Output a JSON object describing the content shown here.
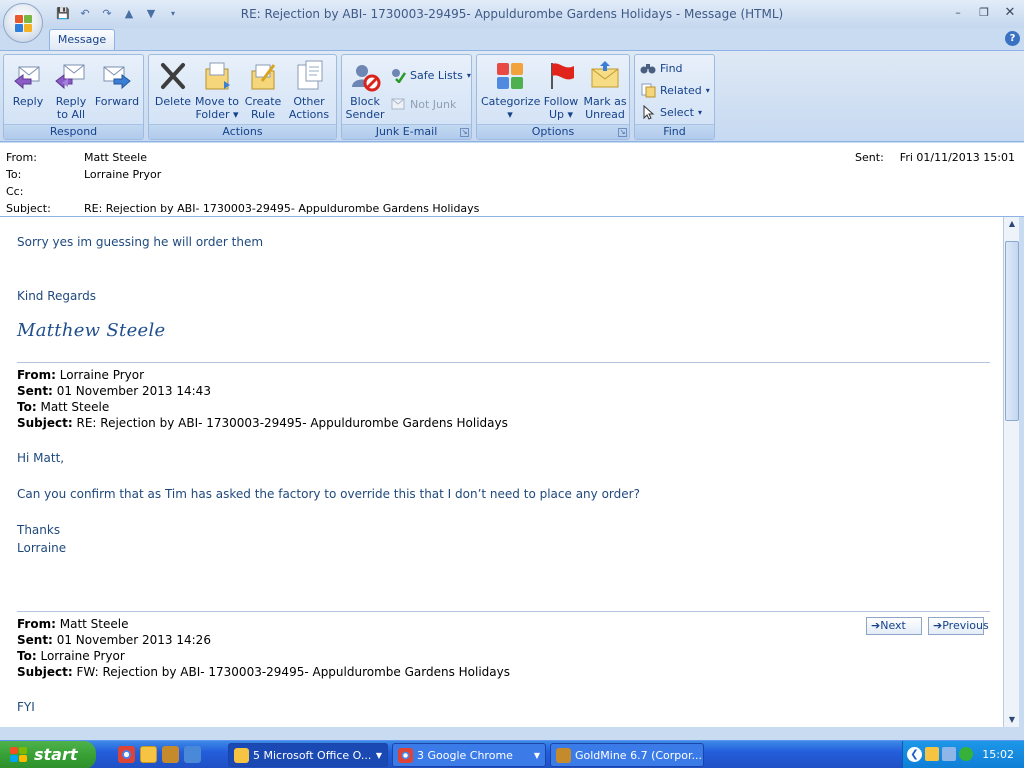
{
  "window": {
    "title": "RE: Rejection by ABI- 1730003-29495- Appuldurombe Gardens Holidays - Message (HTML)"
  },
  "ribbon": {
    "tab": "Message",
    "groups": {
      "respond": "Respond",
      "actions": "Actions",
      "junk": "Junk E-mail",
      "options": "Options",
      "find": "Find"
    },
    "reply": "Reply",
    "reply_all_1": "Reply",
    "reply_all_2": "to All",
    "forward": "Forward",
    "delete": "Delete",
    "move_1": "Move to",
    "move_2": "Folder",
    "create_1": "Create",
    "create_2": "Rule",
    "other_1": "Other",
    "other_2": "Actions",
    "block_1": "Block",
    "block_2": "Sender",
    "safe_lists": "Safe Lists",
    "not_junk": "Not Junk",
    "categorize": "Categorize",
    "follow_1": "Follow",
    "follow_2": "Up",
    "mark_1": "Mark as",
    "mark_2": "Unread",
    "find": "Find",
    "related": "Related",
    "select": "Select"
  },
  "header": {
    "from_label": "From:",
    "from": "Matt Steele",
    "to_label": "To:",
    "to": "Lorraine Pryor",
    "cc_label": "Cc:",
    "cc": "",
    "subject_label": "Subject:",
    "subject": "RE: Rejection by ABI- 1730003-29495- Appuldurombe Gardens Holidays",
    "sent_label": "Sent:",
    "sent": "Fri 01/11/2013 15:01"
  },
  "body": {
    "line1": "Sorry yes im guessing he will order them",
    "regards": "Kind Regards",
    "signature": "Matthew Steele",
    "q1": {
      "from_label": "From:",
      "from": "Lorraine Pryor",
      "sent_label": "Sent:",
      "sent": "01 November 2013 14:43",
      "to_label": "To:",
      "to": "Matt Steele",
      "subject_label": "Subject:",
      "subject": "RE: Rejection by ABI- 1730003-29495- Appuldurombe Gardens Holidays",
      "greeting": "Hi Matt,",
      "text": "Can you confirm that as Tim has asked the factory to override this that I don’t need to place any order?",
      "thanks": "Thanks",
      "name": "Lorraine"
    },
    "q2": {
      "from_label": "From:",
      "from": "Matt Steele",
      "sent_label": "Sent:",
      "sent": "01 November 2013 14:26",
      "to_label": "To:",
      "to": "Lorraine Pryor",
      "subject_label": "Subject:",
      "subject": "FW: Rejection by ABI- 1730003-29495- Appuldurombe Gardens Holidays",
      "text": "FYI"
    },
    "next": "Next",
    "previous": "Previous"
  },
  "taskbar": {
    "start": "start",
    "tasks": [
      "5 Microsoft Office O...",
      "3 Google Chrome",
      "GoldMine 6.7 (Corpor..."
    ],
    "clock": "15:02"
  },
  "colors": {
    "accent": "#15428b",
    "body_text": "#1f497d",
    "taskbar": "#245edb"
  }
}
